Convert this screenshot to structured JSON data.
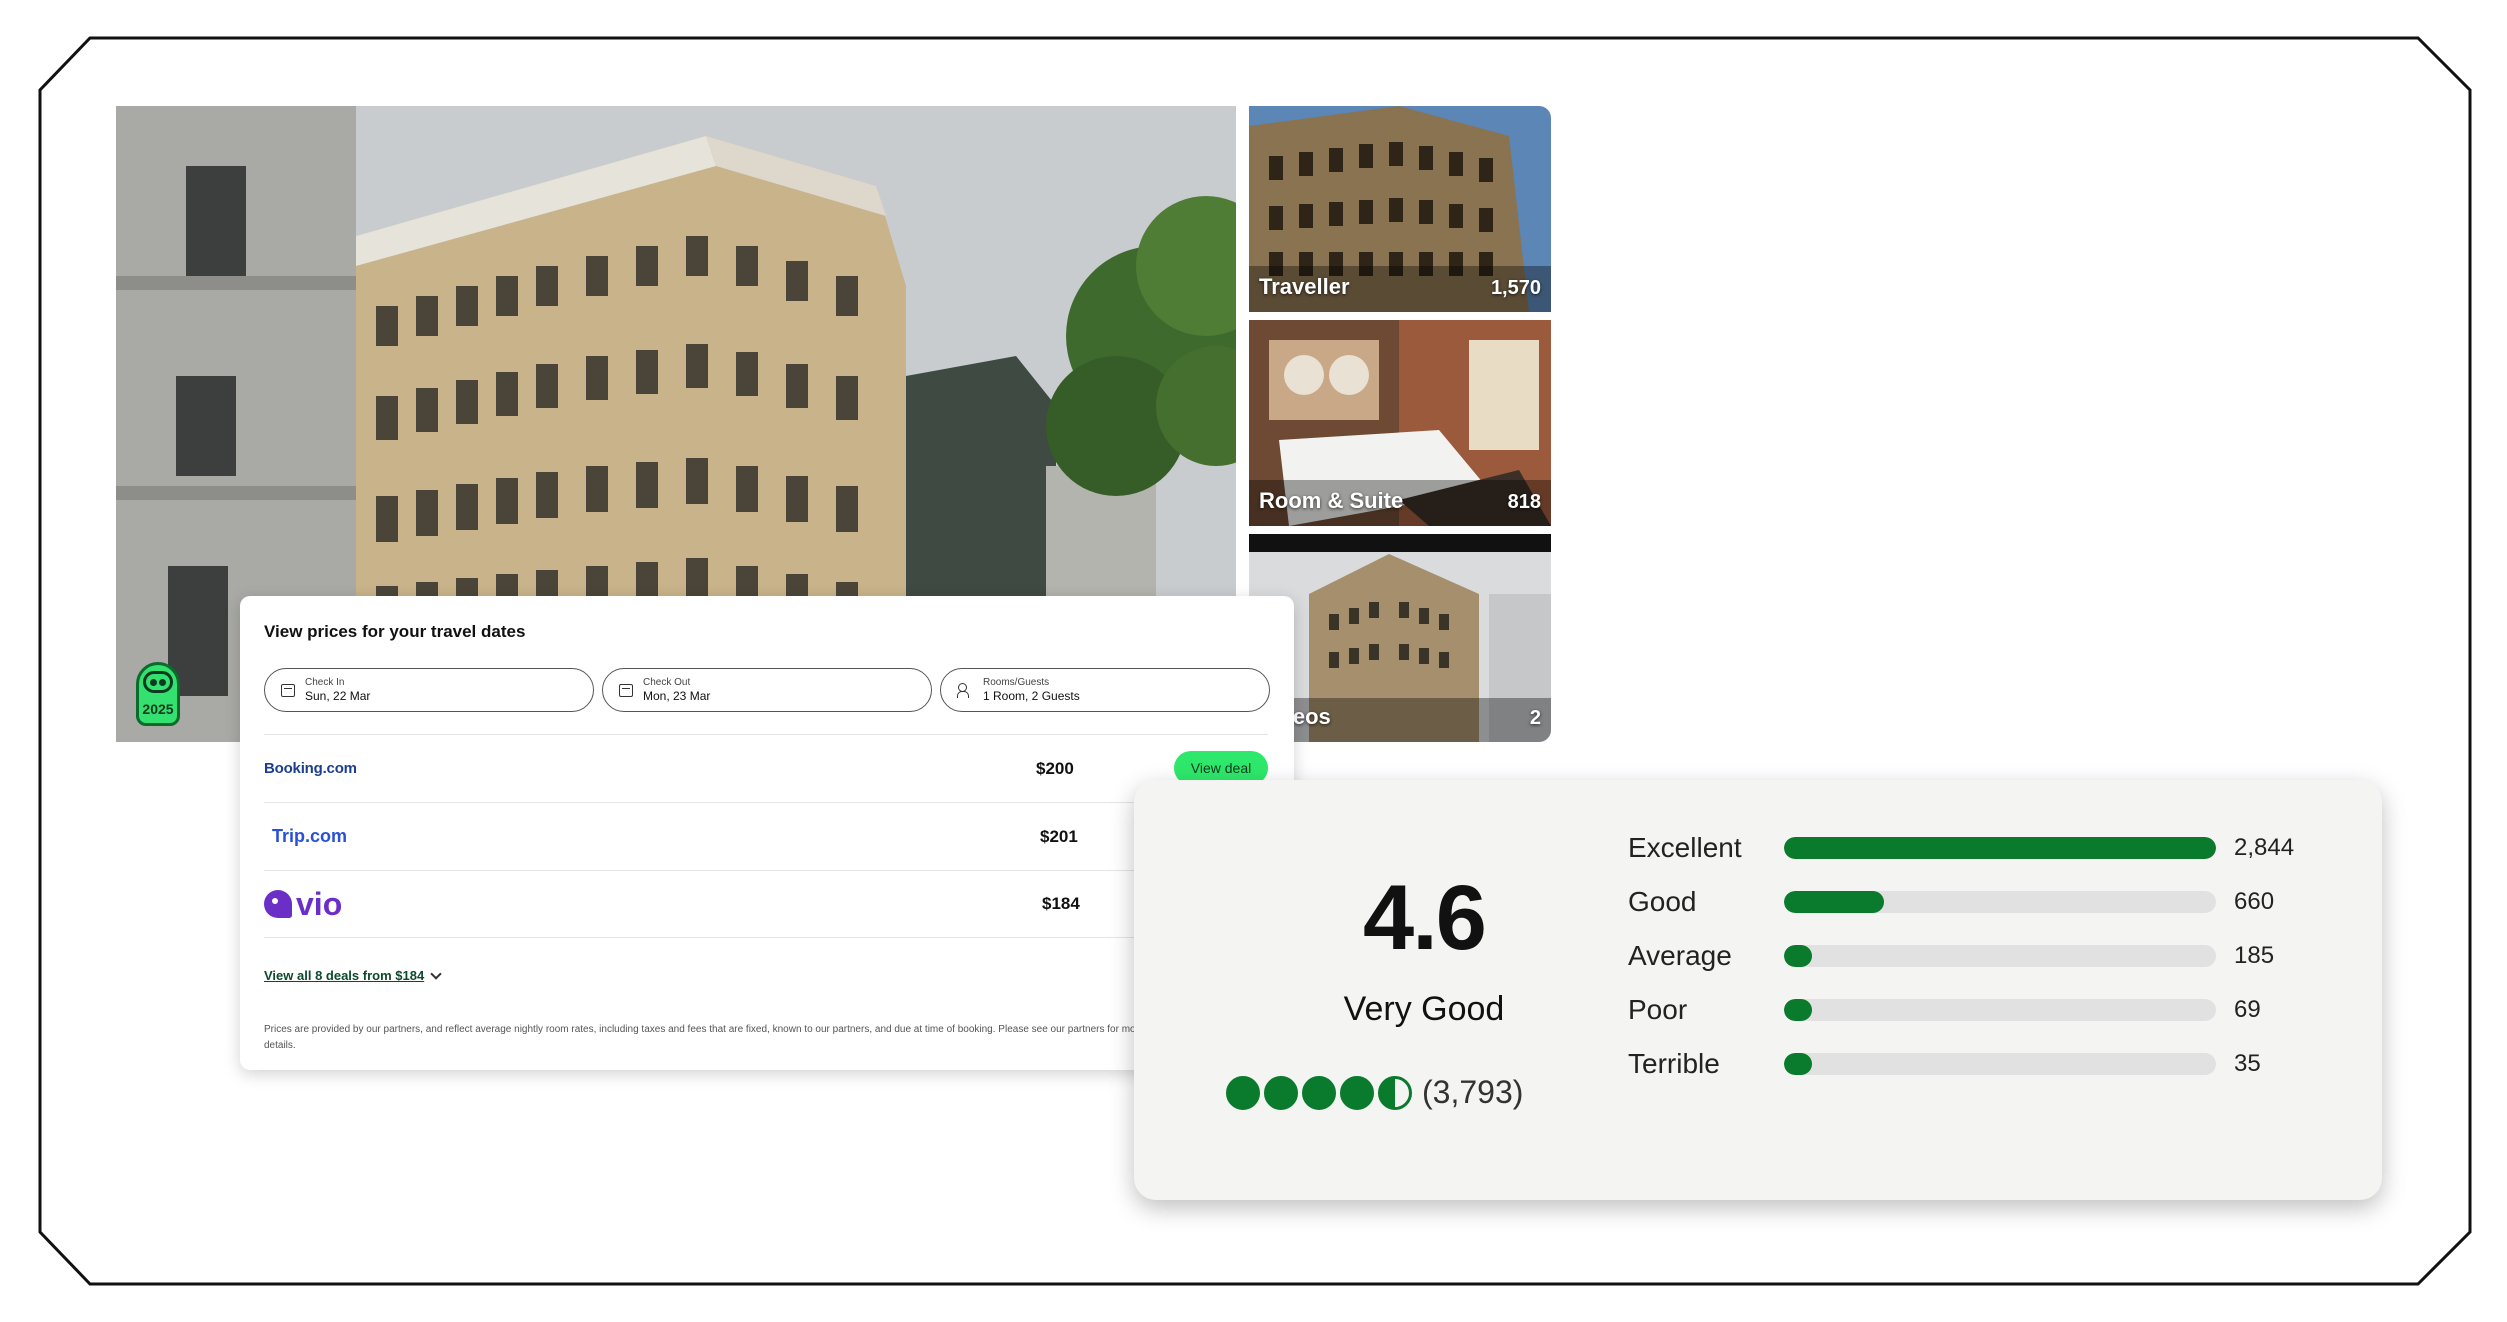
{
  "hero": {
    "award_year": "2025"
  },
  "gallery": {
    "items": [
      {
        "label": "Traveller",
        "count": "1,570"
      },
      {
        "label": "Room & Suite",
        "count": "818"
      },
      {
        "label": "Videos",
        "count": "2"
      }
    ]
  },
  "prices": {
    "title": "View prices for your travel dates",
    "check_in": {
      "caption": "Check In",
      "value": "Sun, 22 Mar"
    },
    "check_out": {
      "caption": "Check Out",
      "value": "Mon, 23 Mar"
    },
    "rooms": {
      "caption": "Rooms/Guests",
      "value": "1 Room, 2 Guests"
    },
    "deals": [
      {
        "provider": "Booking.com",
        "price": "$200",
        "button": "View deal"
      },
      {
        "provider": "Trip.com",
        "price": "$201"
      },
      {
        "provider": "vio",
        "price": "$184"
      }
    ],
    "view_all": "View all 8 deals from $184",
    "disclaimer": "Prices are provided by our partners, and reflect average nightly room rates, including taxes and fees that are fixed, known to our partners, and due at time of booking. Please see our partners for more details."
  },
  "rating": {
    "score": "4.6",
    "label": "Very Good",
    "bubbles": 4.5,
    "review_count": "(3,793)",
    "max_count": 2844,
    "distribution": [
      {
        "label": "Excellent",
        "count": 2844,
        "display": "2,844"
      },
      {
        "label": "Good",
        "count": 660,
        "display": "660"
      },
      {
        "label": "Average",
        "count": 185,
        "display": "185"
      },
      {
        "label": "Poor",
        "count": 69,
        "display": "69"
      },
      {
        "label": "Terrible",
        "count": 35,
        "display": "35"
      }
    ],
    "colors": {
      "bar": "#0a7a2c",
      "track": "#e1e1e1"
    }
  }
}
